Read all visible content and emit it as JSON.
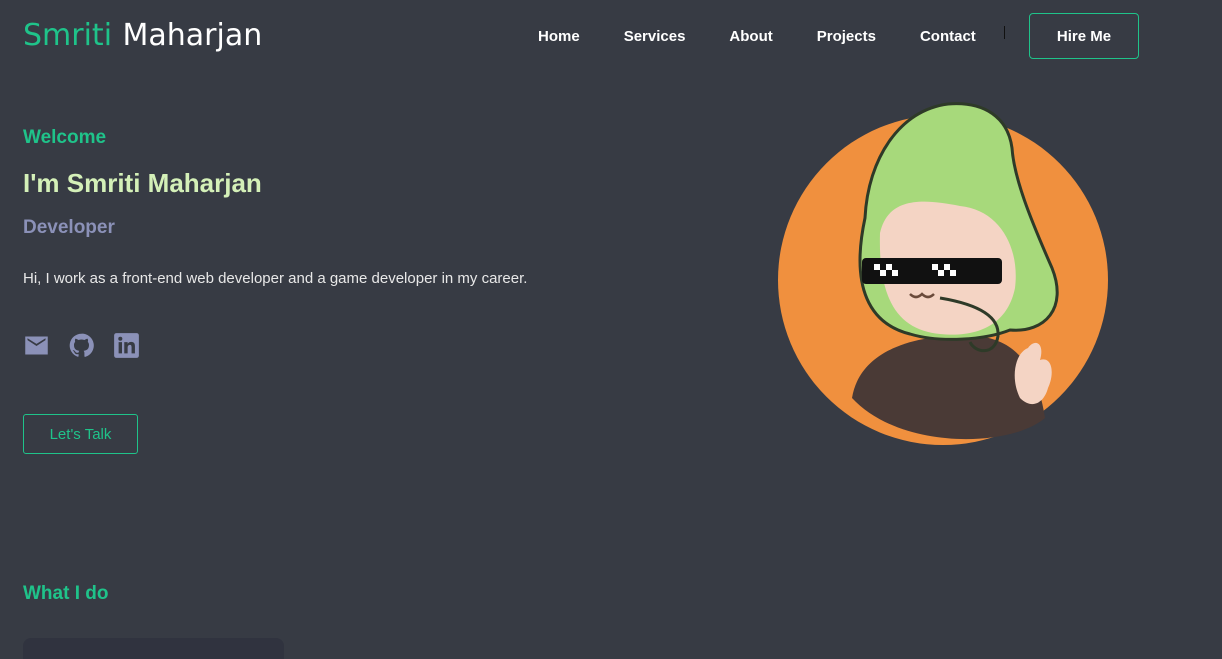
{
  "header": {
    "logo_first": "Smriti",
    "logo_last": "Maharjan",
    "nav": [
      "Home",
      "Services",
      "About",
      "Projects",
      "Contact"
    ],
    "hire_label": "Hire Me"
  },
  "hero": {
    "welcome": "Welcome",
    "intro": "I'm Smriti Maharjan",
    "role": "Developer",
    "bio": "Hi, I work as a front-end web developer and a game developer in my career.",
    "socials": [
      "mail-icon",
      "github-icon",
      "linkedin-icon"
    ],
    "cta_label": "Let's Talk"
  },
  "section": {
    "title": "What I do"
  },
  "colors": {
    "background": "#373b44",
    "accent": "#1fc38a",
    "intro": "#d4f0b8",
    "role": "#8b91b8",
    "icon": "#8b91b8",
    "avatar_circle": "#f0903e",
    "hood": "#a7d97b"
  }
}
